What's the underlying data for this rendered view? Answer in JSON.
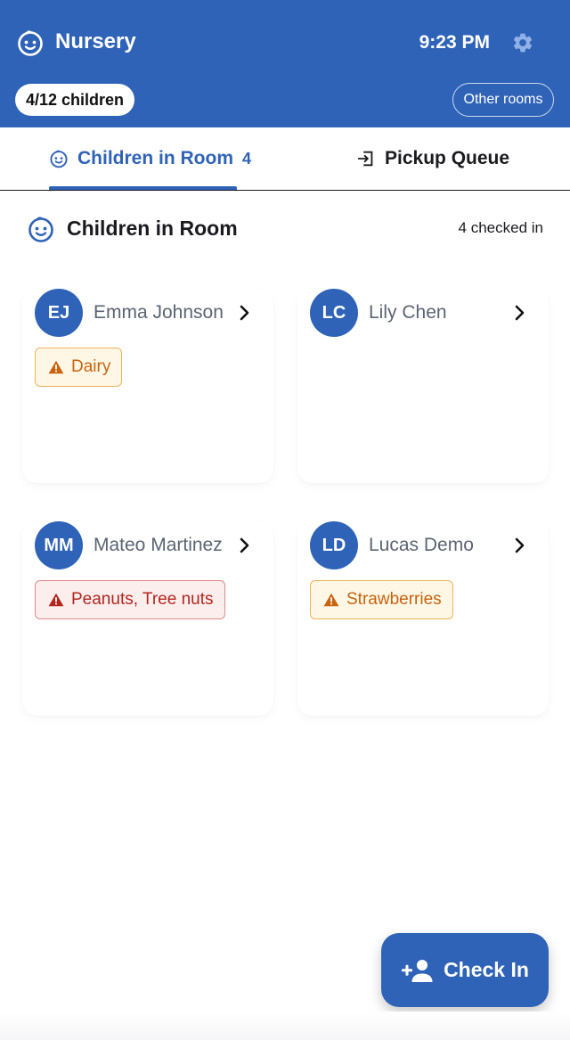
{
  "header": {
    "title": "Nursery",
    "time": "9:23 PM",
    "child_count": "4/12 children",
    "other_rooms_label": "Other rooms",
    "logo_icon": "baby-face-icon",
    "settings_icon": "gear-icon",
    "background_color": "#2f63b8"
  },
  "tabs": [
    {
      "label": "Children in Room",
      "count": "4",
      "icon": "baby-face-icon",
      "selected": true
    },
    {
      "label": "Pickup Queue",
      "icon": "exit-arrow-icon",
      "selected": false
    }
  ],
  "section": {
    "title": "Children in Room",
    "count_text": "4 checked in",
    "icon": "baby-face-icon"
  },
  "children": [
    {
      "initials": "EJ",
      "name": "Emma Johnson",
      "allergy": "Dairy",
      "severity": "moderate"
    },
    {
      "initials": "LC",
      "name": "Lily Chen"
    },
    {
      "initials": "MM",
      "name": "Mateo Martinez",
      "allergy": "Peanuts, Tree nuts",
      "severity": "severe"
    },
    {
      "initials": "LD",
      "name": "Lucas Demo",
      "allergy": "Strawberries",
      "severity": "moderate"
    }
  ],
  "fab": {
    "label": "Check In",
    "icon": "person-add-icon"
  },
  "colors": {
    "primary": "#2f63b8",
    "warning_orange": "#c9630f",
    "danger_red": "#b3261e"
  }
}
